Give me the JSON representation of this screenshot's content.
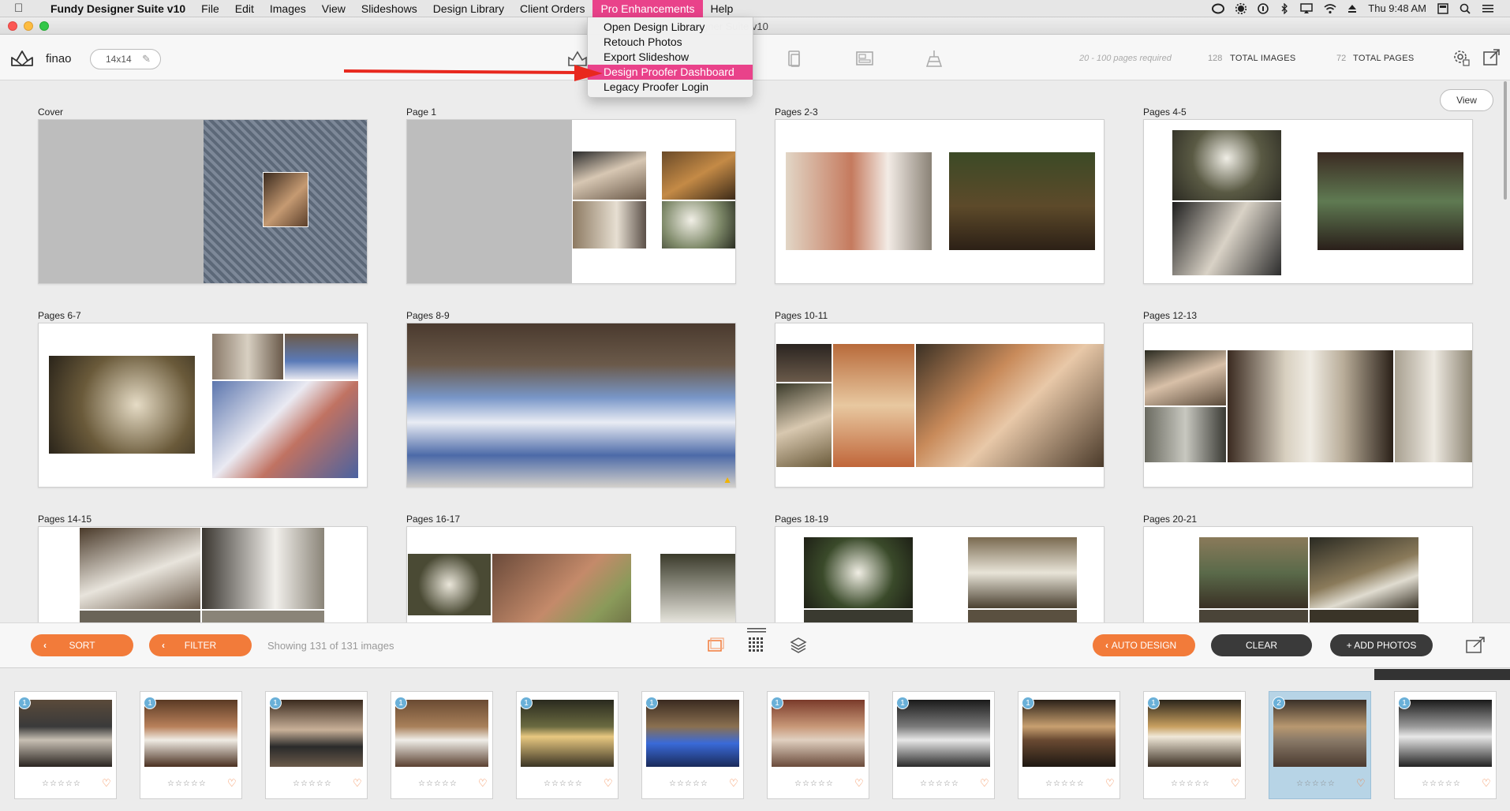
{
  "menubar": {
    "apple": "",
    "app_name": "Fundy Designer Suite v10",
    "menus": [
      "File",
      "Edit",
      "Images",
      "View",
      "Slideshows",
      "Design Library",
      "Client Orders",
      "Pro Enhancements",
      "Help"
    ],
    "active_menu": "Pro Enhancements",
    "clock": "Thu 9:48 AM"
  },
  "window": {
    "title_fragment": "gner Suite v10"
  },
  "dropdown": {
    "items": [
      "Open Design Library",
      "Retouch Photos",
      "Export Slideshow",
      "Design Proofer Dashboard",
      "Legacy Proofer Login"
    ],
    "highlighted": "Design Proofer Dashboard"
  },
  "toolbar": {
    "project_name": "finao",
    "album_size": "14x14",
    "pages_required": "20 - 100 pages required",
    "total_images_count": "128",
    "total_images_label": "TOTAL IMAGES",
    "total_pages_count": "72",
    "total_pages_label": "TOTAL PAGES"
  },
  "grid": {
    "view_button": "View",
    "spreads": [
      {
        "label": "Cover"
      },
      {
        "label": "Page 1"
      },
      {
        "label": "Pages 2-3"
      },
      {
        "label": "Pages 4-5"
      },
      {
        "label": "Pages 6-7"
      },
      {
        "label": "Pages 8-9"
      },
      {
        "label": "Pages 10-11"
      },
      {
        "label": "Pages 12-13"
      },
      {
        "label": "Pages 14-15"
      },
      {
        "label": "Pages 16-17"
      },
      {
        "label": "Pages 18-19"
      },
      {
        "label": "Pages 20-21"
      }
    ]
  },
  "actionbar": {
    "sort": "SORT",
    "filter": "FILTER",
    "showing": "Showing 131 of 131 images",
    "auto_design": "AUTO DESIGN",
    "clear": "CLEAR",
    "add_photos": "+ ADD PHOTOS"
  },
  "filmstrip": {
    "stars": "☆☆☆☆☆",
    "heart": "♡",
    "thumbs": [
      {
        "badge": "1",
        "selected": false
      },
      {
        "badge": "1",
        "selected": false
      },
      {
        "badge": "1",
        "selected": false
      },
      {
        "badge": "1",
        "selected": false
      },
      {
        "badge": "1",
        "selected": false
      },
      {
        "badge": "1",
        "selected": false
      },
      {
        "badge": "1",
        "selected": false
      },
      {
        "badge": "1",
        "selected": false
      },
      {
        "badge": "1",
        "selected": false
      },
      {
        "badge": "1",
        "selected": false
      },
      {
        "badge": "2",
        "selected": true
      },
      {
        "badge": "1",
        "selected": false
      }
    ]
  },
  "colors": {
    "menu_highlight": "#e9428a",
    "orange_button": "#f27b3a",
    "dark_button": "#3a3a3a",
    "badge_blue": "#6ab0d8",
    "arrow_red": "#e8281e"
  }
}
